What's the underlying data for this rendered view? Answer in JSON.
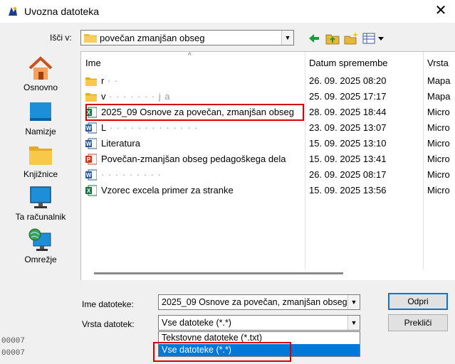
{
  "window": {
    "title": "Uvozna datoteka",
    "close_glyph": "✕"
  },
  "lookin": {
    "label": "Išči v:",
    "value": "povečan zmanjšan obseg"
  },
  "places": [
    {
      "label": "Osnovno",
      "icon": "home-icon"
    },
    {
      "label": "Namizje",
      "icon": "desktop-icon"
    },
    {
      "label": "Knjižnice",
      "icon": "libraries-icon"
    },
    {
      "label": "Ta računalnik",
      "icon": "computer-icon"
    },
    {
      "label": "Omrežje",
      "icon": "network-icon"
    }
  ],
  "columns": {
    "name": "Ime",
    "date": "Datum spremembe",
    "type": "Vrsta"
  },
  "files": [
    {
      "name": "r",
      "masked": " · ·",
      "date": "26. 09. 2025 08:20",
      "type": "Mapa",
      "icon": "folder-icon"
    },
    {
      "name": "v",
      "masked": " · · · · · · · j a",
      "date": "25. 09. 2025 17:17",
      "type": "Mapa",
      "icon": "folder-icon"
    },
    {
      "name": "2025_09 Osnove za povečan, zmanjšan obseg",
      "masked": "",
      "date": "28. 09. 2025 18:44",
      "type": "Micro",
      "icon": "excel-icon"
    },
    {
      "name": "L",
      "masked": " · · · · · · · · · · · · ·",
      "date": "23. 09. 2025 13:07",
      "type": "Micro",
      "icon": "word-icon"
    },
    {
      "name": "Literatura",
      "masked": "",
      "date": "15. 09. 2025 13:10",
      "type": "Micro",
      "icon": "word-icon"
    },
    {
      "name": "Povečan-zmanjšan obseg pedagoškega dela",
      "masked": "",
      "date": "15. 09. 2025 13:41",
      "type": "Micro",
      "icon": "powerpoint-icon"
    },
    {
      "name": "",
      "masked": " · · · · · · · · ·",
      "date": "26. 09. 2025 08:17",
      "type": "Micro",
      "icon": "word-icon"
    },
    {
      "name": "Vzorec excela primer za stranke",
      "masked": "",
      "date": "15. 09. 2025 13:56",
      "type": "Micro",
      "icon": "excel-icon"
    }
  ],
  "filename": {
    "label": "Ime datoteke:",
    "value": "2025_09 Osnove za povečan, zmanjšan obseg"
  },
  "filetype": {
    "label": "Vrsta datotek:",
    "value": "Vse datoteke (*.*)",
    "options": [
      "Tekstovne datoteke (*.txt)",
      "Vse datoteke (*.*)"
    ]
  },
  "buttons": {
    "open": "Odpri",
    "cancel": "Prekliči"
  },
  "background": {
    "row1": "00007",
    "row2": "00007"
  },
  "colors": {
    "highlight_border": "#d40000",
    "selection": "#0078d7"
  }
}
